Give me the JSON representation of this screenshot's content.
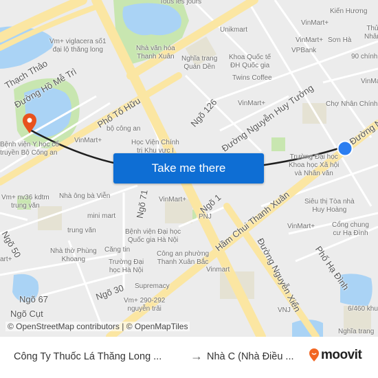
{
  "map": {
    "labels": {
      "tous_les_jours": "Tous les jours",
      "vm_viglacera": "Vm+ viglacera số1\nđại lộ thăng long",
      "nha_van_hoa": "Nhà văn hóa\nThanh Xuân",
      "unikmart": "Unikmart",
      "nghia_trang_quan_den": "Nghĩa trang\nQuán Dền",
      "khoa_quoc_te": "Khoa Quốc tế\nĐH Quốc gia",
      "twins_coffee": "Twins Coffee",
      "kien_huong": "Kiến Hương",
      "vinmart1": "VinMart+",
      "vinmart2": "VinMart+",
      "son_ha": "Sơn Hà",
      "vpbank": "VPBank",
      "thu_nhan": "Thủ\nNhân",
      "chinh_90": "90 chính k",
      "vinmart3": "VinMa",
      "vinmart4": "VinMart+",
      "cho_nhan_chinh": "Chợ Nhân Chính",
      "bo_cong_an": "bộ công an",
      "vinmart5": "VinMart+",
      "hoc_vien": "Học Viện Chính\ntrị Khu vực I",
      "benh_vien_y_hoc": "Bệnh viện Y học cổ\ntruyền Bộ Công an",
      "truong_dai_hoc_khxh": "Trường Đại học\nKhoa học Xã hội\nvà Nhân văn",
      "vm_nv36": "Vm+ nv36 kdtm\ntrung văn",
      "nha_ong_ba_vien": "Nhà ông bà Viễn",
      "mini_mart": "mini mart",
      "vinmart6": "VinMart+",
      "pnj": "PNJ",
      "trung_van": "trung văn",
      "benh_vien_dhqg": "Bệnh viện Đại học\nQuốc gia Hà Nội",
      "nha_tho": "Nhà thờ Phùng\nKhoang",
      "cang_tin": "Căng tin",
      "truong_dh_hn": "Trường Đại\nhọc Hà Nội",
      "cong_an_phuong": "Công an phường\nThanh Xuân Bắc",
      "vinmart_left": "art+",
      "supremacy": "Supremacy",
      "vinmart_siêu": "Siêu thị Tòa nhà\nHuy Hoàng",
      "vinmart7": "VinMart+",
      "cong_chung_cu": "Cổng chung\ncư Hạ Đình",
      "vinmart_lower": "Vinmart",
      "vm_290": "Vm+ 290-292\nnguyễn trãi",
      "vnj": "VNJ",
      "khu_6460": "6/460 khu",
      "nghia_trang2": "Nghĩa trang"
    },
    "streets": {
      "thach_thao": "Thạch Thảo",
      "ho_me_tri": "Đường Hồ Mễ Trì",
      "to_huu": "Phố Tố Hữu",
      "ngo_126": "Ngõ 126",
      "nguyen_huy_tuong": "Đường Nguyễn Huy Tưởng",
      "duong_n": "Đường N",
      "ngo_71": "Ngõ 71",
      "ngo_1": "Ngõ 1",
      "ham_chui": "Hầm Chui Thanh Xuân",
      "nguyen_xien": "Đường Nguyễn Xiển",
      "pho_ha_dinh": "Phố Hạ Đình",
      "ngo_50": "Ngõ 50",
      "ngo_30": "Ngõ 30",
      "ngo_67": "Ngõ 67",
      "ngo_cut": "Ngõ Cụt"
    },
    "destination_marker": "map-pin-icon",
    "origin_marker": "current-location-dot",
    "colors": {
      "route": "#1f1f1f",
      "pin": "#e8521e",
      "origin": "#2c7ef0",
      "cta": "#0e6ed4",
      "water": "#aad3f5",
      "park": "#c8e6b0",
      "major_road": "#fbe6a2"
    }
  },
  "cta": {
    "label": "Take me there"
  },
  "attribution": "© OpenStreetMap contributors | © OpenMapTiles",
  "footer": {
    "from": "Công Ty Thuốc Lá Thăng Long ...",
    "arrow": "→",
    "to": "Nhà C (Nhà Điều ...",
    "brand": "moovit",
    "brand_color": "#f26622"
  }
}
